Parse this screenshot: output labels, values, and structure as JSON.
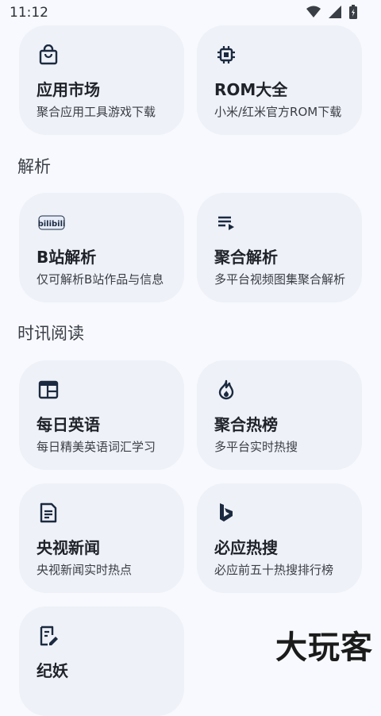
{
  "status": {
    "time": "11:12"
  },
  "sections": {
    "parse": "解析",
    "news": "时讯阅读"
  },
  "cards": {
    "app_market": {
      "title": "应用市场",
      "subtitle": "聚合应用工具游戏下载",
      "icon": "shopping-bag-icon"
    },
    "rom": {
      "title": "ROM大全",
      "subtitle": "小米/红米官方ROM下载",
      "icon": "chip-icon"
    },
    "bili": {
      "title": "B站解析",
      "subtitle": "仅可解析B站作品与信息",
      "icon": "bilibili-icon"
    },
    "agg_parse": {
      "title": "聚合解析",
      "subtitle": "多平台视频图集聚合解析",
      "icon": "playlist-icon"
    },
    "english": {
      "title": "每日英语",
      "subtitle": "每日精美英语词汇学习",
      "icon": "calendar-table-icon"
    },
    "hot": {
      "title": "聚合热榜",
      "subtitle": "多平台实时热搜",
      "icon": "flame-icon"
    },
    "cctv": {
      "title": "央视新闻",
      "subtitle": "央视新闻实时热点",
      "icon": "document-icon"
    },
    "bing": {
      "title": "必应热搜",
      "subtitle": "必应前五十热搜排行榜",
      "icon": "bing-icon"
    },
    "jiyao": {
      "title": "纪妖",
      "subtitle": "",
      "icon": "edit-note-icon"
    }
  },
  "watermark": "大玩客",
  "colors": {
    "background": "#f7f9fe",
    "card": "#eef1f7",
    "icon": "#1b2a40"
  }
}
